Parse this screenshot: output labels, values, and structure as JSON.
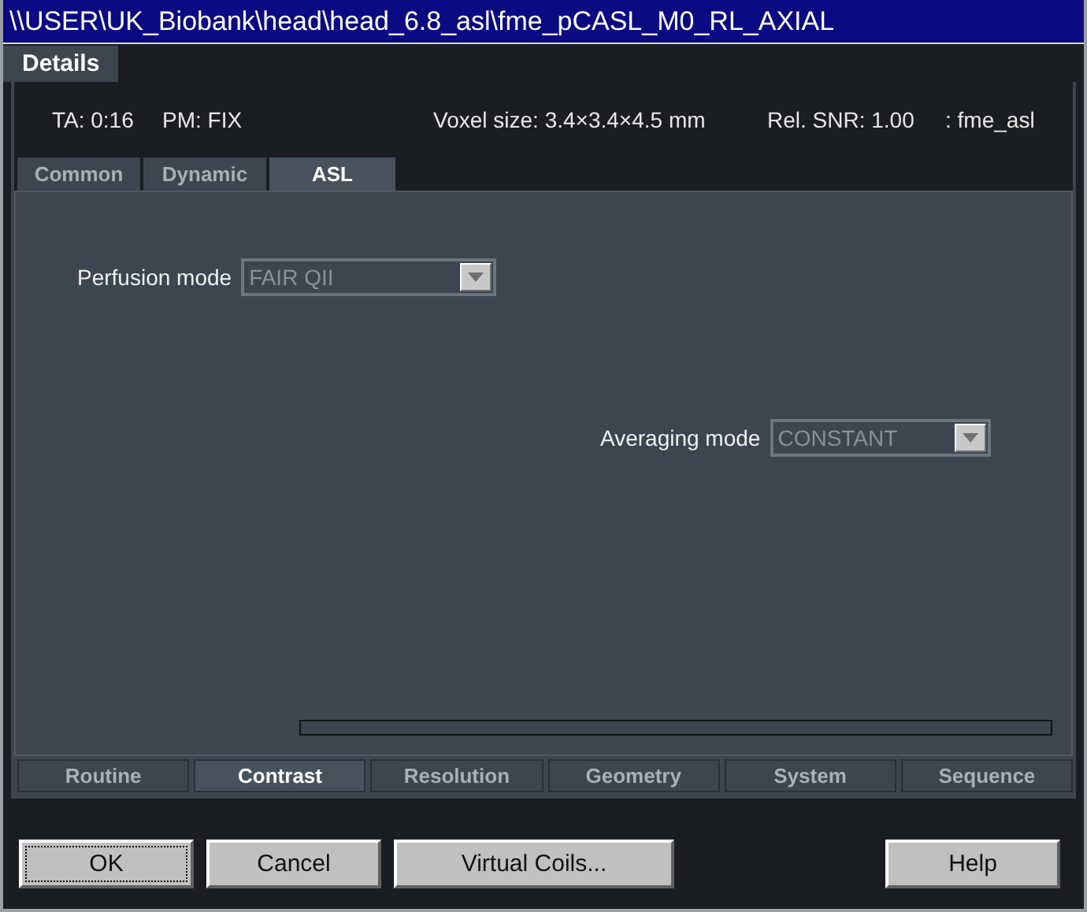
{
  "window": {
    "title": "\\\\USER\\UK_Biobank\\head\\head_6.8_asl\\fme_pCASL_M0_RL_AXIAL"
  },
  "top_tabs": [
    {
      "label": "Details",
      "selected": true
    }
  ],
  "info": [
    "TA: 0:16",
    "PM: FIX",
    "Voxel size: 3.4×3.4×4.5 mm",
    "Rel. SNR: 1.00",
    ": fme_asl"
  ],
  "sub_tabs": [
    {
      "label": "Common",
      "selected": false
    },
    {
      "label": "Dynamic",
      "selected": false
    },
    {
      "label": "ASL",
      "selected": true
    }
  ],
  "fields": [
    {
      "label": "Perfusion mode",
      "value": "FAIR QII",
      "disabled": true
    },
    {
      "label": "Averaging mode",
      "value": "CONSTANT",
      "disabled": true
    }
  ],
  "progress": {
    "level": 0
  },
  "bottom_tabs": [
    {
      "label": "Routine",
      "selected": false
    },
    {
      "label": "Contrast",
      "selected": true
    },
    {
      "label": "Resolution",
      "selected": false
    },
    {
      "label": "Geometry",
      "selected": false
    },
    {
      "label": "System",
      "selected": false
    },
    {
      "label": "Sequence",
      "selected": false
    }
  ],
  "buttons": [
    {
      "label": "OK",
      "focused": true
    },
    {
      "label": "Cancel",
      "focused": false
    },
    {
      "label": "Virtual Coils...",
      "focused": false
    },
    {
      "label": "Help",
      "focused": false
    }
  ]
}
